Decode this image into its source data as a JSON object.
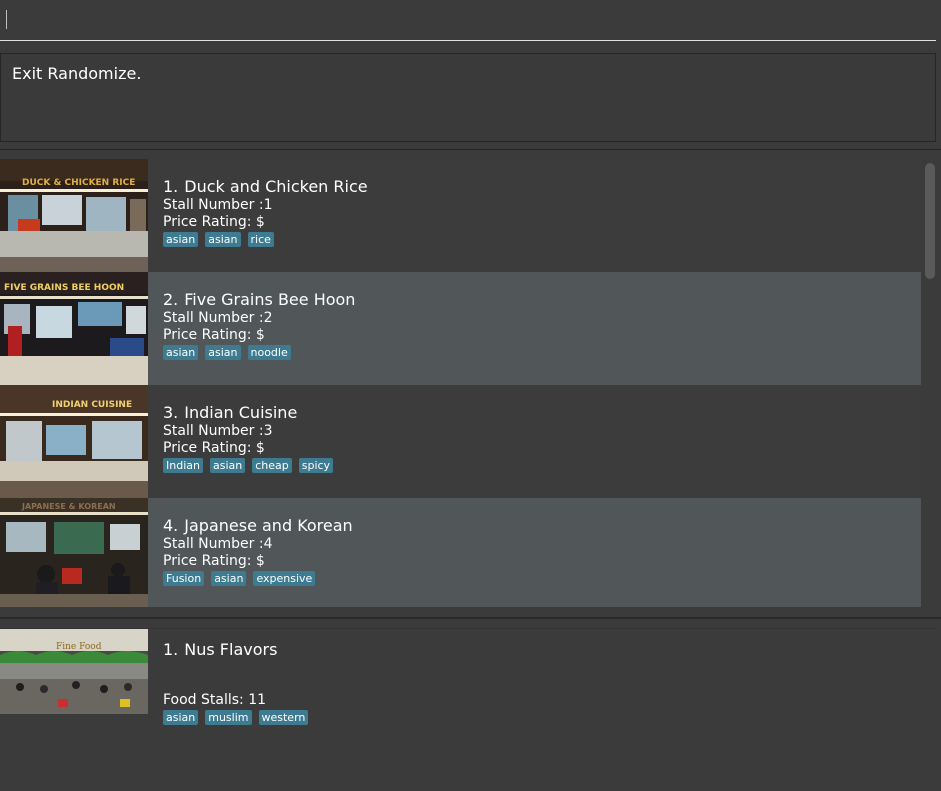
{
  "command": {
    "value": ""
  },
  "result": {
    "message": "Exit Randomize."
  },
  "stalls": [
    {
      "index": "1.",
      "name": "Duck and Chicken Rice",
      "stall_label": "Stall Number :1",
      "price_label": "Price Rating: $",
      "tags": [
        "asian",
        "asian",
        "rice"
      ],
      "sign": "DUCK & CHICKEN RICE"
    },
    {
      "index": "2.",
      "name": "Five Grains Bee Hoon",
      "stall_label": "Stall Number :2",
      "price_label": "Price Rating: $",
      "tags": [
        "asian",
        "asian",
        "noodle"
      ],
      "sign": "FIVE GRAINS BEE HOON"
    },
    {
      "index": "3.",
      "name": "Indian Cuisine",
      "stall_label": "Stall Number :3",
      "price_label": "Price Rating: $",
      "tags": [
        "Indian",
        "asian",
        "cheap",
        "spicy"
      ],
      "sign": "INDIAN CUISINE"
    },
    {
      "index": "4.",
      "name": "Japanese and Korean",
      "stall_label": "Stall Number :4",
      "price_label": "Price Rating: $",
      "tags": [
        "Fusion",
        "asian",
        "expensive"
      ],
      "sign": "JAPANESE & KOREAN"
    }
  ],
  "canteen": {
    "index": "1.",
    "name": "Nus Flavors",
    "stalls_label": "Food Stalls: 11",
    "tags": [
      "asian",
      "muslim",
      "western"
    ],
    "sign": "Fine Food"
  }
}
